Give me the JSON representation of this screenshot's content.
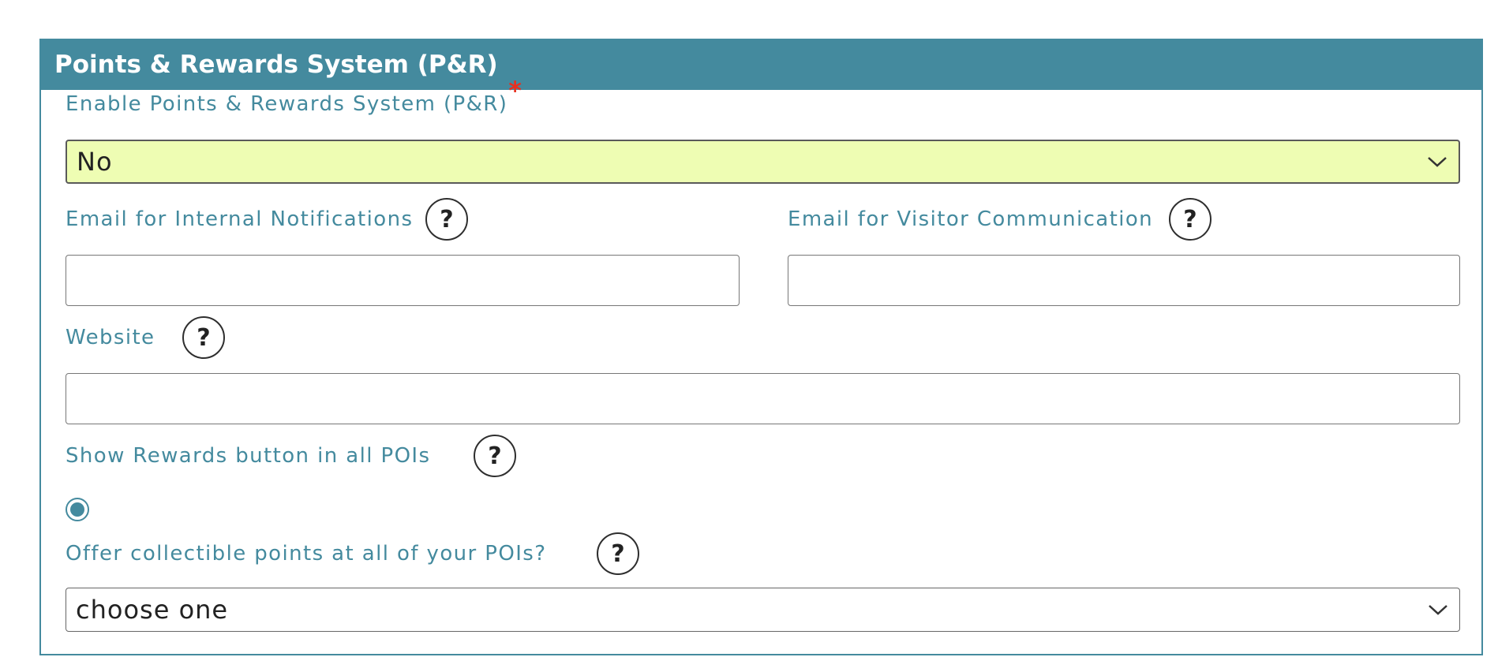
{
  "section": {
    "title": "Points & Rewards System (P&R)"
  },
  "fields": {
    "enable_pr": {
      "label": "Enable Points & Rewards System (P&R)",
      "required_mark": "*",
      "value": "No"
    },
    "email_internal": {
      "label": "Email for Internal Notifications",
      "value": ""
    },
    "email_visitor": {
      "label": "Email for Visitor Communication",
      "value": ""
    },
    "website": {
      "label": "Website",
      "value": ""
    },
    "show_rewards": {
      "label": "Show Rewards button in all POIs",
      "selected": true
    },
    "offer_points": {
      "label": "Offer collectible points at all of your POIs?",
      "value": "choose one"
    }
  },
  "help_glyph": "?",
  "icons": {
    "help": "question-circle-icon",
    "dropdown": "chevron-down-icon"
  },
  "colors": {
    "accent": "#448a9e",
    "required": "#e8301f",
    "highlight_select_bg": "#eefdb3"
  }
}
